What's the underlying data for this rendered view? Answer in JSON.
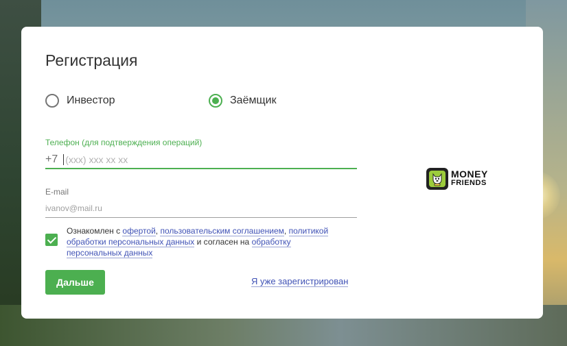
{
  "form": {
    "title": "Регистрация",
    "roles": [
      {
        "label": "Инвестор",
        "selected": false
      },
      {
        "label": "Заёмщик",
        "selected": true
      }
    ],
    "phone": {
      "label": "Телефон (для подтверждения операций)",
      "prefix": "+7",
      "placeholder": "(xxx) xxx xx xx",
      "value": ""
    },
    "email": {
      "label": "E-mail",
      "placeholder": "ivanov@mail.ru",
      "value": ""
    },
    "consent": {
      "checked": true,
      "text_1": "Ознакомлен с ",
      "link_offer": "офертой",
      "sep_1": ", ",
      "link_agreement": "пользовательским соглашением",
      "sep_2": ", ",
      "link_policy": "политикой обработки персональных данных",
      "text_2": " и согласен на ",
      "link_processing": "обработку персональных данных"
    },
    "next_label": "Дальше",
    "login_link": "Я уже зарегистрирован"
  },
  "logo": {
    "line1": "MONEY",
    "line2": "FRIENDS",
    "badge_color": "#222222",
    "accent": "#9ccc3b"
  },
  "colors": {
    "accent_green": "#4caf50",
    "link_blue": "#3f51b5"
  }
}
